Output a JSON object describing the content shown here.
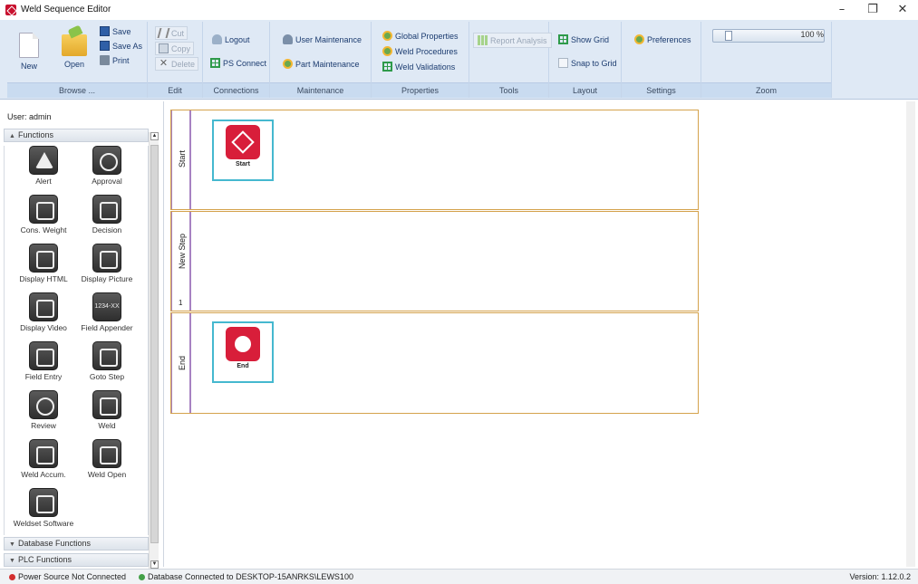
{
  "window": {
    "title": "Weld Sequence Editor",
    "minimize": "–",
    "restore": "❐",
    "close": "✕"
  },
  "ribbon": {
    "browse": {
      "label": "Browse ...",
      "new": "New",
      "open": "Open",
      "save": "Save",
      "save_as": "Save As",
      "print": "Print"
    },
    "edit": {
      "label": "Edit",
      "cut": "Cut",
      "copy": "Copy",
      "delete": "Delete"
    },
    "connections": {
      "label": "Connections",
      "logout": "Logout",
      "ps_connect": "PS Connect"
    },
    "maintenance": {
      "label": "Maintenance",
      "user": "User Maintenance",
      "part": "Part Maintenance"
    },
    "properties": {
      "label": "Properties",
      "global": "Global Properties",
      "weld_procedures": "Weld Procedures",
      "weld_validations": "Weld Validations"
    },
    "tools": {
      "label": "Tools",
      "report": "Report Analysis"
    },
    "layout": {
      "label": "Layout",
      "show_grid": "Show Grid",
      "snap_to_grid": "Snap to Grid"
    },
    "settings": {
      "label": "Settings",
      "preferences": "Preferences"
    },
    "zoom": {
      "label": "Zoom",
      "value": "100 %",
      "level": 0.1
    }
  },
  "sidebar": {
    "user": "User: admin",
    "functions_header": "Functions",
    "database_header": "Database Functions",
    "plc_header": "PLC Functions",
    "tools": [
      {
        "label": "Alert"
      },
      {
        "label": "Approval"
      },
      {
        "label": "Cons. Weight"
      },
      {
        "label": "Decision"
      },
      {
        "label": "Display HTML"
      },
      {
        "label": "Display Picture"
      },
      {
        "label": "Display Video"
      },
      {
        "label": "Field Appender",
        "glyph": "1234-XX"
      },
      {
        "label": "Field Entry"
      },
      {
        "label": "Goto Step"
      },
      {
        "label": "Review"
      },
      {
        "label": "Weld"
      },
      {
        "label": "Weld Accum."
      },
      {
        "label": "Weld Open"
      },
      {
        "label": "Weldset Software"
      }
    ]
  },
  "canvas": {
    "lanes": [
      {
        "title": "Start",
        "number": ""
      },
      {
        "title": "New Step",
        "number": "1"
      },
      {
        "title": "End",
        "number": ""
      }
    ],
    "steps": [
      {
        "label": "Start"
      },
      {
        "label": "End"
      }
    ]
  },
  "status": {
    "power": "Power Source Not Connected",
    "power_color": "#d32f2f",
    "database": "Database Connected to DESKTOP-15ANRKS\\LEWS100",
    "database_color": "#43a047",
    "version": "Version: 1.12.0.2"
  }
}
